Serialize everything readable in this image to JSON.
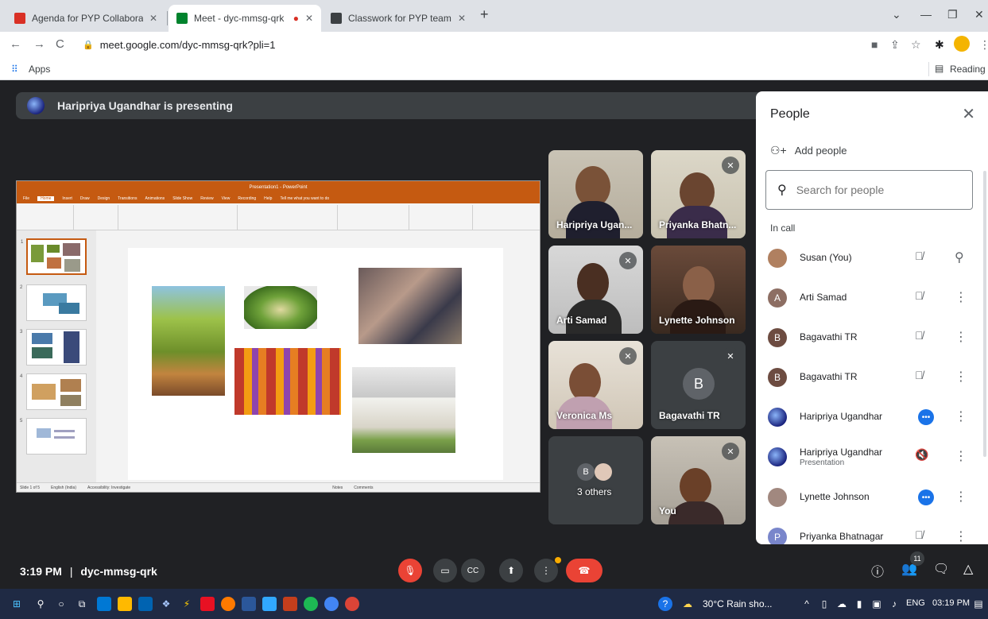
{
  "browser": {
    "tabs": [
      {
        "title": "Agenda for PYP Collaboration M",
        "favicon_color": "#d93025",
        "active": false
      },
      {
        "title": "Meet - dyc-mmsg-qrk",
        "favicon_color": "#00832d",
        "active": true
      },
      {
        "title": "Classwork for PYP team @Gatew",
        "favicon_color": "#3c4043",
        "active": false
      }
    ],
    "new_tab_label": "+",
    "url": "meet.google.com/dyc-mmsg-qrk?pli=1",
    "bookmarks": {
      "apps_label": "Apps",
      "reading_list_label": "Reading list"
    }
  },
  "meet": {
    "presenting_banner": "Haripriya Ugandhar is presenting",
    "tiles": [
      {
        "name": "Haripriya Ugan...",
        "muted": false
      },
      {
        "name": "Priyanka Bhatn...",
        "muted": true
      },
      {
        "name": "Arti Samad",
        "muted": true
      },
      {
        "name": "Lynette Johnson",
        "muted": false
      },
      {
        "name": "Veronica Ms",
        "muted": true
      },
      {
        "name": "Bagavathi TR",
        "muted": true,
        "avatar_letter": "B"
      },
      {
        "name": "3 others",
        "avatar_letter": "B"
      },
      {
        "name": "You",
        "muted": true
      }
    ],
    "bottom_bar": {
      "time": "3:19 PM",
      "separator": "|",
      "meeting_code": "dyc-mmsg-qrk",
      "participant_count": "11"
    }
  },
  "people_panel": {
    "title": "People",
    "add_people_label": "Add people",
    "search_placeholder": "Search for people",
    "section_label": "In call",
    "participants": [
      {
        "name": "Susan (You)",
        "avatar": "",
        "avatar_color": "#b08060",
        "state": "muted"
      },
      {
        "name": "Arti Samad",
        "avatar": "A",
        "avatar_color": "#8d6e63",
        "state": "muted"
      },
      {
        "name": "Bagavathi TR",
        "avatar": "B",
        "avatar_color": "#6d4c41",
        "state": "muted"
      },
      {
        "name": "Bagavathi TR",
        "avatar": "B",
        "avatar_color": "#6d4c41",
        "state": "muted"
      },
      {
        "name": "Haripriya Ugandhar",
        "avatar": "",
        "avatar_color": "#1a237e",
        "state": "speaking"
      },
      {
        "name": "Haripriya Ugandhar",
        "sub": "Presentation",
        "avatar": "",
        "avatar_color": "#1a237e",
        "state": "presenting"
      },
      {
        "name": "Lynette Johnson",
        "avatar": "",
        "avatar_color": "#a1887f",
        "state": "speaking"
      },
      {
        "name": "Priyanka Bhatnagar",
        "avatar": "P",
        "avatar_color": "#7986cb",
        "state": "muted"
      }
    ]
  },
  "shared_slide": {
    "app_title": "Presentation1 - PowerPoint",
    "menu": [
      "File",
      "Home",
      "Insert",
      "Draw",
      "Design",
      "Transitions",
      "Animations",
      "Slide Show",
      "Review",
      "View",
      "Recording",
      "Help",
      "Tell me what you want to do"
    ],
    "slide_numbers": [
      "1",
      "2",
      "3",
      "4",
      "5"
    ],
    "status": "Slide 1 of 5",
    "status_lang": "English (India)",
    "status_access": "Accessibility: Investigate",
    "status_notes": "Notes",
    "status_comments": "Comments"
  },
  "taskbar": {
    "weather": "30°C  Rain sho...",
    "lang": "ENG",
    "clock": "03:19 PM"
  }
}
